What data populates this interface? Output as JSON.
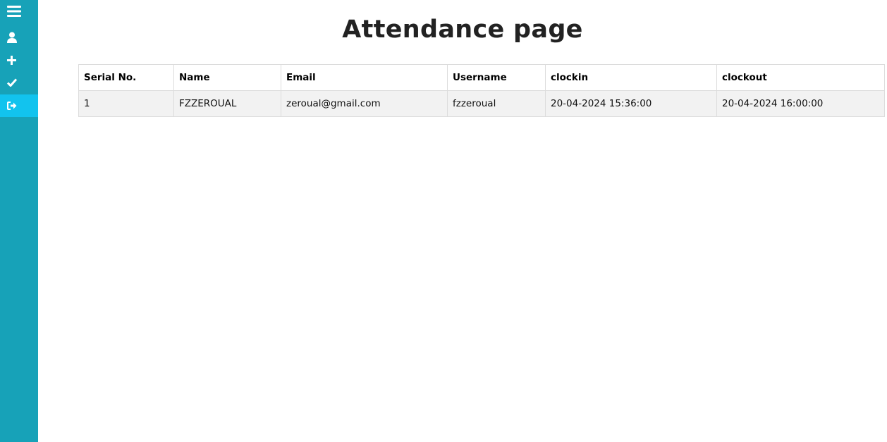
{
  "sidebar": {
    "items": [
      {
        "icon": "menu-icon"
      },
      {
        "icon": "user-icon"
      },
      {
        "icon": "plus-icon"
      },
      {
        "icon": "check-icon"
      },
      {
        "icon": "sign-out-icon",
        "active": true
      }
    ],
    "colors": {
      "background": "#17a2b8",
      "active": "#12c3ee"
    }
  },
  "page": {
    "title": "Attendance page"
  },
  "table": {
    "headers": [
      "Serial No.",
      "Name",
      "Email",
      "Username",
      "clockin",
      "clockout"
    ],
    "rows": [
      [
        "1",
        "FZZEROUAL",
        "zeroual@gmail.com",
        "fzzeroual",
        "20-04-2024 15:36:00",
        "20-04-2024 16:00:00"
      ]
    ]
  }
}
